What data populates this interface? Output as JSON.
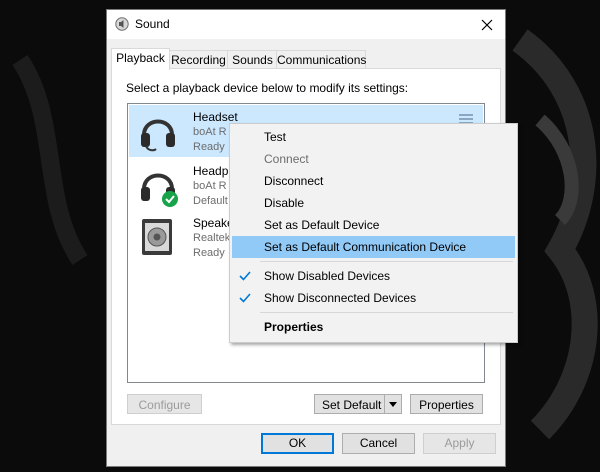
{
  "window": {
    "title": "Sound",
    "icon": "speaker-icon"
  },
  "tabs": [
    {
      "label": "Playback",
      "active": true
    },
    {
      "label": "Recording",
      "active": false
    },
    {
      "label": "Sounds",
      "active": false
    },
    {
      "label": "Communications",
      "active": false
    }
  ],
  "instruction": "Select a playback device below to modify its settings:",
  "devices": [
    {
      "name": "Headset",
      "line1": "boAt R",
      "line2": "Ready",
      "icon": "headset-icon",
      "selected": true
    },
    {
      "name": "Headpl",
      "line1": "boAt R",
      "line2": "Default",
      "icon": "headphones-default-icon",
      "selected": false
    },
    {
      "name": "Speake",
      "line1": "Realtek",
      "line2": "Ready",
      "icon": "speaker-device-icon",
      "selected": false
    }
  ],
  "buttons": {
    "configure": "Configure",
    "set_default": "Set Default",
    "properties": "Properties",
    "ok": "OK",
    "cancel": "Cancel",
    "apply": "Apply"
  },
  "context_menu": {
    "items": [
      {
        "label": "Test",
        "state": "normal"
      },
      {
        "label": "Connect",
        "state": "disabled"
      },
      {
        "label": "Disconnect",
        "state": "normal"
      },
      {
        "label": "Disable",
        "state": "normal"
      },
      {
        "label": "Set as Default Device",
        "state": "normal"
      },
      {
        "label": "Set as Default Communication Device",
        "state": "highlighted"
      },
      {
        "label": "Show Disabled Devices",
        "state": "checked"
      },
      {
        "label": "Show Disconnected Devices",
        "state": "checked"
      },
      {
        "label": "Properties",
        "state": "bold"
      }
    ]
  },
  "colors": {
    "selection": "#cce8ff",
    "menu_highlight": "#91c9f7",
    "check": "#0078d7",
    "default_badge": "#16a34a"
  }
}
